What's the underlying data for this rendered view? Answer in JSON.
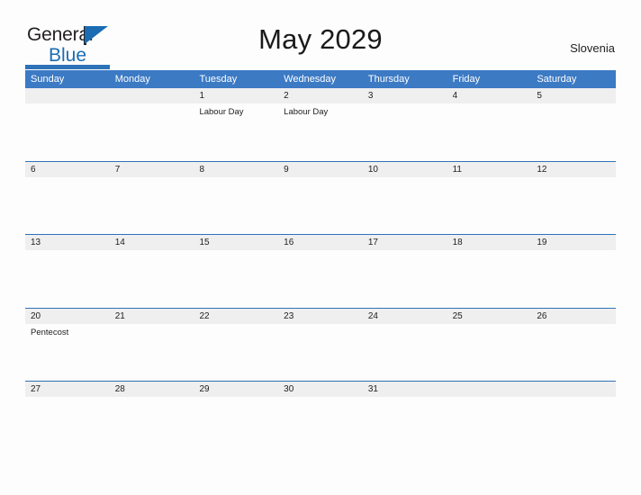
{
  "brand": {
    "name_part1": "General",
    "name_part2": "Blue",
    "accent_color": "#1b6cb3"
  },
  "header": {
    "title": "May 2029",
    "region": "Slovenia"
  },
  "calendar": {
    "header_bg": "#3c7ac4",
    "date_band_bg": "#efefef",
    "row_line_color": "#2e72b8",
    "weekdays": [
      "Sunday",
      "Monday",
      "Tuesday",
      "Wednesday",
      "Thursday",
      "Friday",
      "Saturday"
    ],
    "weeks": [
      {
        "days": [
          {
            "num": "",
            "events": []
          },
          {
            "num": "",
            "events": []
          },
          {
            "num": "1",
            "events": [
              "Labour Day"
            ]
          },
          {
            "num": "2",
            "events": [
              "Labour Day"
            ]
          },
          {
            "num": "3",
            "events": []
          },
          {
            "num": "4",
            "events": []
          },
          {
            "num": "5",
            "events": []
          }
        ]
      },
      {
        "days": [
          {
            "num": "6",
            "events": []
          },
          {
            "num": "7",
            "events": []
          },
          {
            "num": "8",
            "events": []
          },
          {
            "num": "9",
            "events": []
          },
          {
            "num": "10",
            "events": []
          },
          {
            "num": "11",
            "events": []
          },
          {
            "num": "12",
            "events": []
          }
        ]
      },
      {
        "days": [
          {
            "num": "13",
            "events": []
          },
          {
            "num": "14",
            "events": []
          },
          {
            "num": "15",
            "events": []
          },
          {
            "num": "16",
            "events": []
          },
          {
            "num": "17",
            "events": []
          },
          {
            "num": "18",
            "events": []
          },
          {
            "num": "19",
            "events": []
          }
        ]
      },
      {
        "days": [
          {
            "num": "20",
            "events": [
              "Pentecost"
            ]
          },
          {
            "num": "21",
            "events": []
          },
          {
            "num": "22",
            "events": []
          },
          {
            "num": "23",
            "events": []
          },
          {
            "num": "24",
            "events": []
          },
          {
            "num": "25",
            "events": []
          },
          {
            "num": "26",
            "events": []
          }
        ]
      },
      {
        "days": [
          {
            "num": "27",
            "events": []
          },
          {
            "num": "28",
            "events": []
          },
          {
            "num": "29",
            "events": []
          },
          {
            "num": "30",
            "events": []
          },
          {
            "num": "31",
            "events": []
          },
          {
            "num": "",
            "events": []
          },
          {
            "num": "",
            "events": []
          }
        ]
      }
    ]
  }
}
